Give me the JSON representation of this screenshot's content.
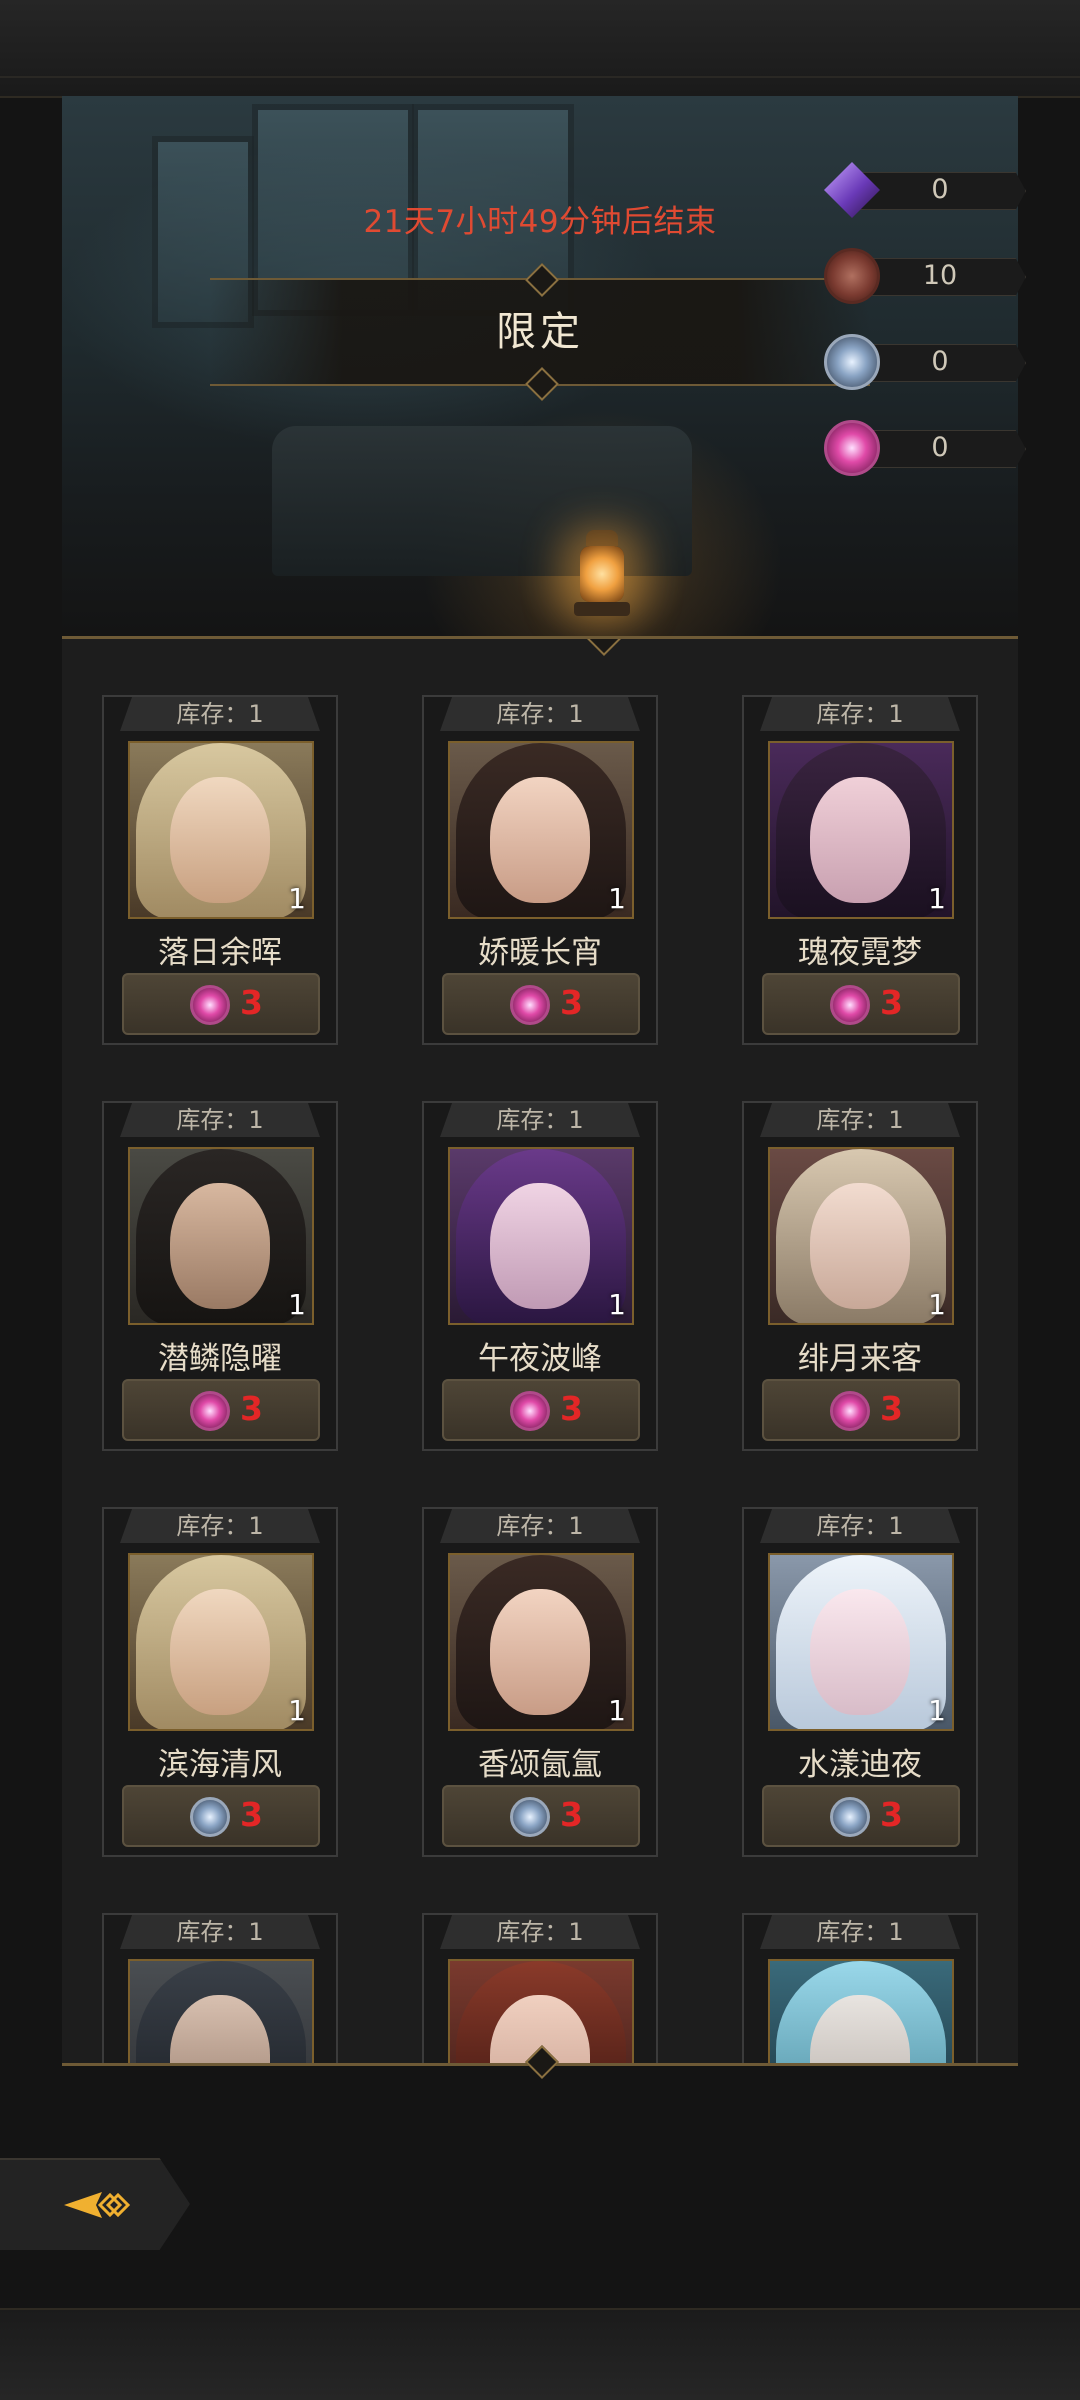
{
  "event": {
    "countdown": "21天7小时49分钟后结束",
    "title": "限定"
  },
  "currencies": [
    {
      "icon": "purple-crystal-icon",
      "value": "0"
    },
    {
      "icon": "bronze-coin-icon",
      "value": "10"
    },
    {
      "icon": "silver-compass-icon",
      "value": "0"
    },
    {
      "icon": "pink-compass-icon",
      "value": "0"
    }
  ],
  "items": [
    {
      "stock": "库存：1",
      "qty": "1",
      "name": "落日余晖",
      "price": "3",
      "price_icon": "pink-compass-icon"
    },
    {
      "stock": "库存：1",
      "qty": "1",
      "name": "娇暖长宵",
      "price": "3",
      "price_icon": "pink-compass-icon"
    },
    {
      "stock": "库存：1",
      "qty": "1",
      "name": "瑰夜霓梦",
      "price": "3",
      "price_icon": "pink-compass-icon"
    },
    {
      "stock": "库存：1",
      "qty": "1",
      "name": "潜鳞隐曜",
      "price": "3",
      "price_icon": "pink-compass-icon"
    },
    {
      "stock": "库存：1",
      "qty": "1",
      "name": "午夜波峰",
      "price": "3",
      "price_icon": "pink-compass-icon"
    },
    {
      "stock": "库存：1",
      "qty": "1",
      "name": "绯月来客",
      "price": "3",
      "price_icon": "pink-compass-icon"
    },
    {
      "stock": "库存：1",
      "qty": "1",
      "name": "滨海清风",
      "price": "3",
      "price_icon": "silver-compass-icon"
    },
    {
      "stock": "库存：1",
      "qty": "1",
      "name": "香颂氤氲",
      "price": "3",
      "price_icon": "silver-compass-icon"
    },
    {
      "stock": "库存：1",
      "qty": "1",
      "name": "水漾迪夜",
      "price": "3",
      "price_icon": "silver-compass-icon"
    },
    {
      "stock": "库存：1"
    },
    {
      "stock": "库存：1"
    },
    {
      "stock": "库存：1"
    }
  ],
  "colors": {
    "countdown": "#e04a32",
    "price": "#e32626",
    "frame_gold": "#7b5f2c",
    "back_arrow": "#f0b030"
  },
  "nav": {
    "back_icon": "back-arrow-icon"
  }
}
